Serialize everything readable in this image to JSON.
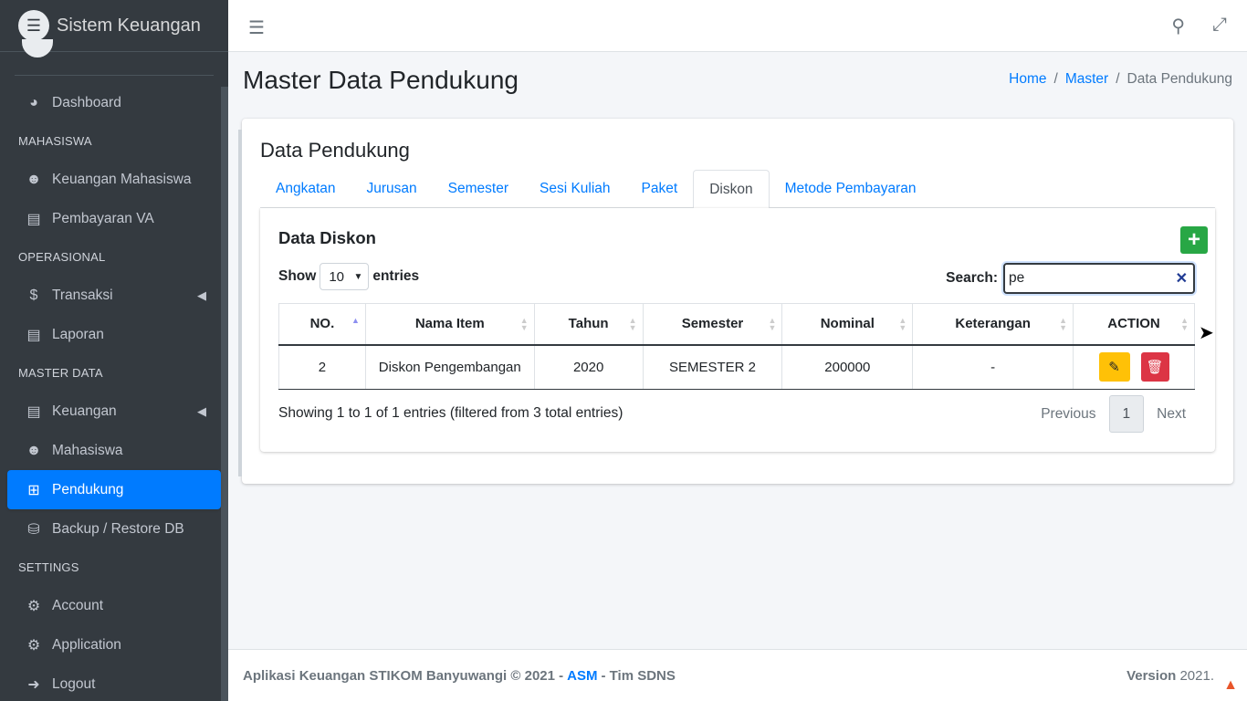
{
  "brand": {
    "name": "Sistem Keuangan"
  },
  "sidebar": {
    "items": [
      {
        "type": "item",
        "label": "Dashboard",
        "icon": "tachometer-icon"
      },
      {
        "type": "header",
        "label": "MAHASISWA"
      },
      {
        "type": "item",
        "label": "Keuangan Mahasiswa",
        "icon": "users-icon"
      },
      {
        "type": "item",
        "label": "Pembayaran VA",
        "icon": "file-invoice-icon"
      },
      {
        "type": "header",
        "label": "OPERASIONAL"
      },
      {
        "type": "item",
        "label": "Transaksi",
        "icon": "dollar-icon",
        "caret": true
      },
      {
        "type": "item",
        "label": "Laporan",
        "icon": "file-icon"
      },
      {
        "type": "header",
        "label": "MASTER DATA"
      },
      {
        "type": "item",
        "label": "Keuangan",
        "icon": "file-invoice-dollar-icon",
        "caret": true
      },
      {
        "type": "item",
        "label": "Mahasiswa",
        "icon": "users-icon"
      },
      {
        "type": "item",
        "label": "Pendukung",
        "icon": "plus-square-icon",
        "active": true
      },
      {
        "type": "item",
        "label": "Backup / Restore DB",
        "icon": "database-icon"
      },
      {
        "type": "header",
        "label": "SETTINGS"
      },
      {
        "type": "item",
        "label": "Account",
        "icon": "user-cog-icon"
      },
      {
        "type": "item",
        "label": "Application",
        "icon": "cogs-icon"
      },
      {
        "type": "item",
        "label": "Logout",
        "icon": "sign-out-icon"
      }
    ]
  },
  "header": {
    "page_title": "Master Data Pendukung",
    "breadcrumb": {
      "home": "Home",
      "master": "Master",
      "current": "Data Pendukung"
    }
  },
  "card": {
    "title": "Data Pendukung",
    "tabs": [
      {
        "label": "Angkatan"
      },
      {
        "label": "Jurusan"
      },
      {
        "label": "Semester"
      },
      {
        "label": "Sesi Kuliah"
      },
      {
        "label": "Paket"
      },
      {
        "label": "Diskon",
        "active": true
      },
      {
        "label": "Metode Pembayaran"
      }
    ]
  },
  "panel": {
    "title": "Data Diskon",
    "show_label": "Show",
    "entries_label": "entries",
    "page_size": "10",
    "search_label": "Search:",
    "search_value": "pe",
    "columns": [
      "NO.",
      "Nama Item",
      "Tahun",
      "Semester",
      "Nominal",
      "Keterangan",
      "ACTION"
    ],
    "rows": [
      {
        "no": "2",
        "nama": "Diskon Pengembangan",
        "tahun": "2020",
        "semester": "SEMESTER 2",
        "nominal": "200000",
        "keterangan": "-"
      }
    ],
    "info": "Showing 1 to 1 of 1 entries (filtered from 3 total entries)",
    "pager": {
      "previous": "Previous",
      "page": "1",
      "next": "Next"
    }
  },
  "footer": {
    "text_before": "Aplikasi Keuangan STIKOM Banyuwangi © 2021 -",
    "link": "ASM",
    "text_after": "- Tim SDNS",
    "version_label": "Version",
    "version_value": "2021."
  },
  "colors": {
    "accent": "#007bff",
    "sidebar": "#343a40",
    "add": "#28a745",
    "edit": "#ffc107",
    "delete": "#dc3545"
  }
}
